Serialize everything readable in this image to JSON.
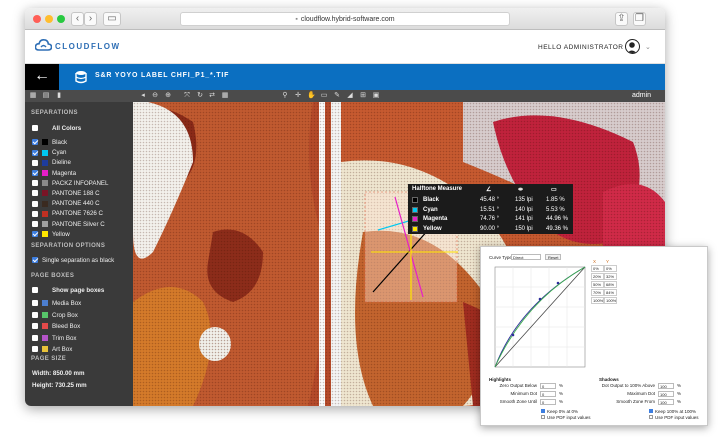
{
  "browser": {
    "url": "cloudflow.hybrid-software.com"
  },
  "app": {
    "brand": "CLOUDFLOW",
    "greeting": "HELLO ADMINISTRATOR"
  },
  "document": {
    "title": "S&R YOYO LABEL CHFI_P1_*.TIF"
  },
  "toolbar": {
    "user": "admin"
  },
  "sidebar": {
    "separations_title": "SEPARATIONS",
    "all_colors": "All Colors",
    "separations": [
      {
        "label": "Black",
        "color": "#000000",
        "checked": true
      },
      {
        "label": "Cyan",
        "color": "#00c8f0",
        "checked": true
      },
      {
        "label": "Dieline",
        "color": "#1e3c9c",
        "checked": false
      },
      {
        "label": "Magenta",
        "color": "#e61ec8",
        "checked": true
      },
      {
        "label": "PACKZ INFOPANEL",
        "color": "#8a8a8a",
        "checked": false
      },
      {
        "label": "PANTONE 188 C",
        "color": "#7a1426",
        "checked": false
      },
      {
        "label": "PANTONE 440 C",
        "color": "#3a2a20",
        "checked": false
      },
      {
        "label": "PANTONE 7626 C",
        "color": "#c03022",
        "checked": false
      },
      {
        "label": "PANTONE Silver C",
        "color": "#a0a0a0",
        "checked": false
      },
      {
        "label": "Yellow",
        "color": "#ffe600",
        "checked": true
      }
    ],
    "sep_options_title": "SEPARATION OPTIONS",
    "single_sep": "Single separation as black",
    "page_boxes_title": "PAGE BOXES",
    "show_page_boxes": "Show page boxes",
    "boxes": [
      {
        "label": "Media Box",
        "color": "#4c7ecf"
      },
      {
        "label": "Crop Box",
        "color": "#57c56a"
      },
      {
        "label": "Bleed Box",
        "color": "#e44a4a"
      },
      {
        "label": "Trim Box",
        "color": "#b554c9"
      },
      {
        "label": "Art Box",
        "color": "#e8c23a"
      }
    ],
    "page_size_title": "PAGE SIZE",
    "width": "Width: 850.00 mm",
    "height": "Height: 730.25 mm"
  },
  "halftone": {
    "title": "Halftone Measure",
    "rows": [
      {
        "name": "Black",
        "color": "#000000",
        "angle": "45.48 °",
        "lpi": "135 lpi",
        "pct": "1.85 %"
      },
      {
        "name": "Cyan",
        "color": "#00c8f0",
        "angle": "15.51 °",
        "lpi": "140 lpi",
        "pct": "5.53 %"
      },
      {
        "name": "Magenta",
        "color": "#e61ec8",
        "angle": "74.76 °",
        "lpi": "141 lpi",
        "pct": "44.96 %"
      },
      {
        "name": "Yellow",
        "color": "#ffe600",
        "angle": "90.00 °",
        "lpi": "150 lpi",
        "pct": "49.36 %"
      }
    ]
  },
  "curve": {
    "curve_type_label": "Curve Type",
    "curve_type_value": "Direct",
    "reset": "Reset",
    "table_headers": [
      "X",
      "Y"
    ],
    "table": [
      [
        "0%",
        "0%"
      ],
      [
        "20%",
        "32%"
      ],
      [
        "50%",
        "68%"
      ],
      [
        "70%",
        "84%"
      ],
      [
        "100%",
        "100%"
      ]
    ],
    "highlights_title": "Highlights",
    "shadows_title": "Shadows",
    "left_fields": [
      {
        "label": "Zero Output Below",
        "value": "0",
        "unit": "%"
      },
      {
        "label": "Minimum Dot",
        "value": "0",
        "unit": "%"
      },
      {
        "label": "Smooth Zone Until",
        "value": "0",
        "unit": "%"
      }
    ],
    "right_fields": [
      {
        "label": "Dot Output to 100% Above",
        "value": "100",
        "unit": "%"
      },
      {
        "label": "Maximum Dot",
        "value": "100",
        "unit": "%"
      },
      {
        "label": "Smooth Zone From",
        "value": "100",
        "unit": "%"
      }
    ],
    "keep_left": "Keep 0% at 0%",
    "pdf_left": "Use PDF input values",
    "keep_right": "Keep 100% at 100%",
    "pdf_right": "Use PDF input values"
  }
}
